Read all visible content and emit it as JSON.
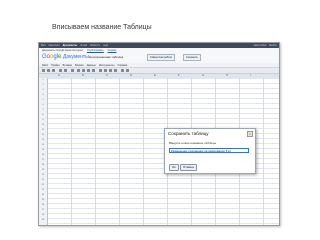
{
  "slide": {
    "title": "Вписываем название Таблицы"
  },
  "app": {
    "topbar": {
      "items": [
        "Веб",
        "Картинки",
        "Документы",
        "Gmail",
        "Новости",
        "ещё"
      ],
      "right": [
        "Настройки",
        "Выйти"
      ]
    },
    "header": {
      "breadcrumb": "Документы Google ваша интернет",
      "breadcrumb_links": [
        "Опубликовать",
        "Сервис"
      ],
      "logo": {
        "g": "G",
        "o1": "o",
        "o2": "o",
        "gl": "g",
        "le": "le",
        "docs": "Документы"
      },
      "doc_title": "Несохраненная таблица",
      "share_btn": "Совместная работа",
      "save_btn": "Сохранить"
    },
    "menu": [
      "Файл",
      "Правка",
      "Вставка",
      "Формат",
      "Данные",
      "Инструменты",
      "Справка"
    ],
    "columns": [
      "A",
      "B",
      "C",
      "D",
      "E",
      "F",
      "G",
      "H",
      "I"
    ],
    "rows": [
      "1",
      "2",
      "3",
      "4",
      "5",
      "6",
      "7",
      "8",
      "9",
      "10",
      "11",
      "12",
      "13",
      "14",
      "15",
      "16",
      "17",
      "18",
      "19",
      "20",
      "21",
      "22",
      "23",
      "24",
      "25",
      "26",
      "27",
      "28",
      "29"
    ]
  },
  "dialog": {
    "title": "Сохранить таблицу",
    "prompt": "Введите новое название таблицы",
    "input_value": "Размещение сохранение на информации 8 кл",
    "ok_label": "Ок",
    "cancel_label": "Отмена"
  }
}
